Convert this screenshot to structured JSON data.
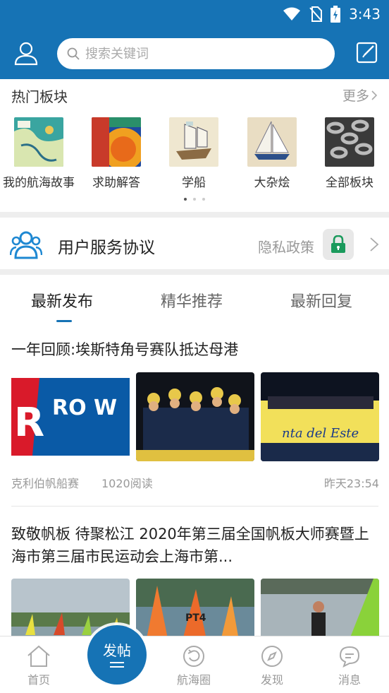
{
  "status": {
    "time": "3:43"
  },
  "header": {
    "search_placeholder": "搜索关键词"
  },
  "hot": {
    "title": "热门板块",
    "more": "更多",
    "boards": [
      {
        "label": "我的航海故事"
      },
      {
        "label": "求助解答"
      },
      {
        "label": "学船"
      },
      {
        "label": "大杂烩"
      },
      {
        "label": "全部板块"
      }
    ],
    "page_indicator": {
      "pages": 3,
      "active": 1
    }
  },
  "agreement": {
    "title": "用户服务协议",
    "privacy": "隐私政策"
  },
  "tabs": [
    {
      "label": "最新发布",
      "active": true
    },
    {
      "label": "精华推荐",
      "active": false
    },
    {
      "label": "最新回复",
      "active": false
    }
  ],
  "posts": [
    {
      "title": "一年回顾:埃斯特角号赛队抵达母港",
      "image1_text": "RO W",
      "image3_text": "nta del Este",
      "source": "克利伯帆船赛",
      "reads": "1020阅读",
      "time": "昨天23:54"
    },
    {
      "title": "致敬帆板 待聚松江  2020年第三届全国帆板大师赛暨上海市第三届市民运动会上海市第...",
      "image2_sail_text": "PT4"
    }
  ],
  "bottom_nav": {
    "home": "首页",
    "post": "发帖",
    "circle": "航海圈",
    "discover": "发现",
    "messages": "消息"
  },
  "colors": {
    "brand_blue": "#1673b5",
    "background_gray": "#eeeeee"
  }
}
